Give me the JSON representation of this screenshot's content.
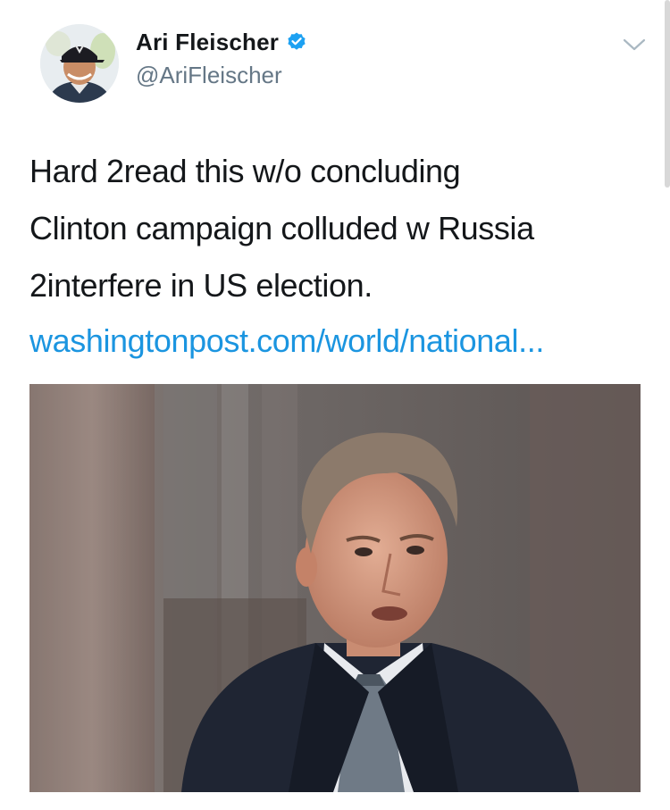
{
  "tweet": {
    "author": {
      "display_name": "Ari Fleischer",
      "handle": "@AriFleischer",
      "verified": true,
      "avatar_icon": "user-avatar-photo"
    },
    "text_lines": [
      "Hard 2read this w/o concluding",
      "Clinton campaign colluded w Russia",
      "2interfere in US election."
    ],
    "link_text": "washingtonpost.com/world/national...",
    "media": {
      "kind": "photo",
      "icon": "photo-man-in-suit"
    }
  },
  "icons": {
    "verified": "verified-badge-icon",
    "menu": "chevron-down-icon"
  },
  "colors": {
    "link": "#1b95e0",
    "verified": "#1da1f2",
    "handle": "#657786",
    "text": "#14171a"
  }
}
